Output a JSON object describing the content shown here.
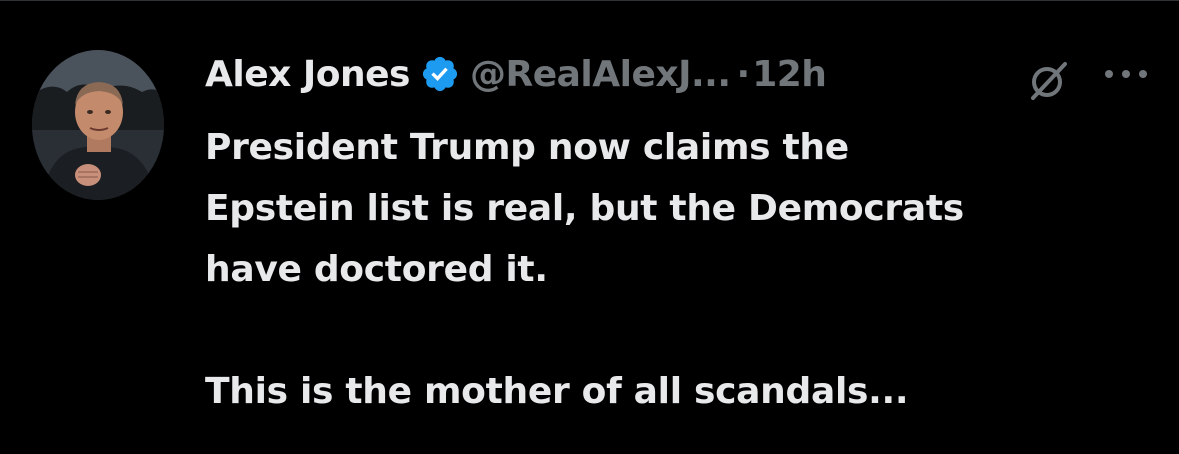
{
  "tweet": {
    "author": {
      "display_name": "Alex Jones",
      "handle": "@RealAlexJ...",
      "verified": true,
      "avatar": "profile-photo"
    },
    "separator": "·",
    "time": "12h",
    "icons": {
      "grok": "grok-icon",
      "more": "more-options-icon",
      "verified": "verified-badge-icon"
    },
    "text_lines": [
      "President Trump now claims the",
      "Epstein list is real, but the Democrats",
      "have doctored it."
    ],
    "text_second_paragraph": "This is the mother of all scandals..."
  },
  "colors": {
    "background": "#000000",
    "primary_text": "#e7e9ea",
    "secondary_text": "#71767b",
    "verified_blue": "#1d9bf0",
    "divider": "#2f3336"
  }
}
